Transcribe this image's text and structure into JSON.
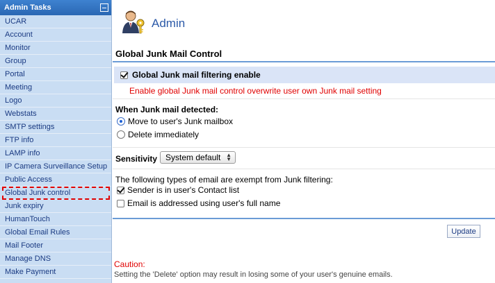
{
  "sidebar": {
    "title": "Admin Tasks",
    "items": [
      {
        "label": "UCAR"
      },
      {
        "label": "Account"
      },
      {
        "label": "Monitor"
      },
      {
        "label": "Group"
      },
      {
        "label": "Portal"
      },
      {
        "label": "Meeting"
      },
      {
        "label": "Logo"
      },
      {
        "label": "Webstats"
      },
      {
        "label": "SMTP settings"
      },
      {
        "label": "FTP info"
      },
      {
        "label": "LAMP info"
      },
      {
        "label": "IP Camera Surveillance Setup"
      },
      {
        "label": "Public Access"
      },
      {
        "label": "Global Junk control",
        "active": true
      },
      {
        "label": "Junk expiry"
      },
      {
        "label": "HumanTouch"
      },
      {
        "label": "Global Email Rules"
      },
      {
        "label": "Mail Footer"
      },
      {
        "label": "Manage DNS"
      },
      {
        "label": "Make Payment"
      }
    ]
  },
  "header": {
    "title": "Admin",
    "icon": "admin-user-key-icon"
  },
  "section_title": "Global Junk Mail Control",
  "enable": {
    "label": "Global Junk mail filtering enable",
    "checked": true,
    "description": "Enable global Junk mail control overwrite user own Junk mail setting"
  },
  "junk_detected": {
    "heading": "When Junk mail detected:",
    "options": [
      {
        "label": "Move to user's Junk mailbox",
        "selected": true
      },
      {
        "label": "Delete immediately",
        "selected": false
      }
    ]
  },
  "sensitivity": {
    "label": "Sensitivity",
    "value": "System default"
  },
  "exempt": {
    "heading": "The following types of email are exempt from Junk filtering:",
    "options": [
      {
        "label": "Sender is in user's Contact list",
        "checked": true
      },
      {
        "label": "Email is addressed using user's full name",
        "checked": false
      }
    ]
  },
  "update_label": "Update",
  "caution": {
    "title": "Caution:",
    "text": "Setting the 'Delete' option may result in losing some of your user's genuine emails."
  },
  "colors": {
    "accent": "#2c5aa8",
    "warning": "#e00000",
    "sidebar_bg": "#c9ddf3",
    "highlight_row": "#dae4f7"
  }
}
